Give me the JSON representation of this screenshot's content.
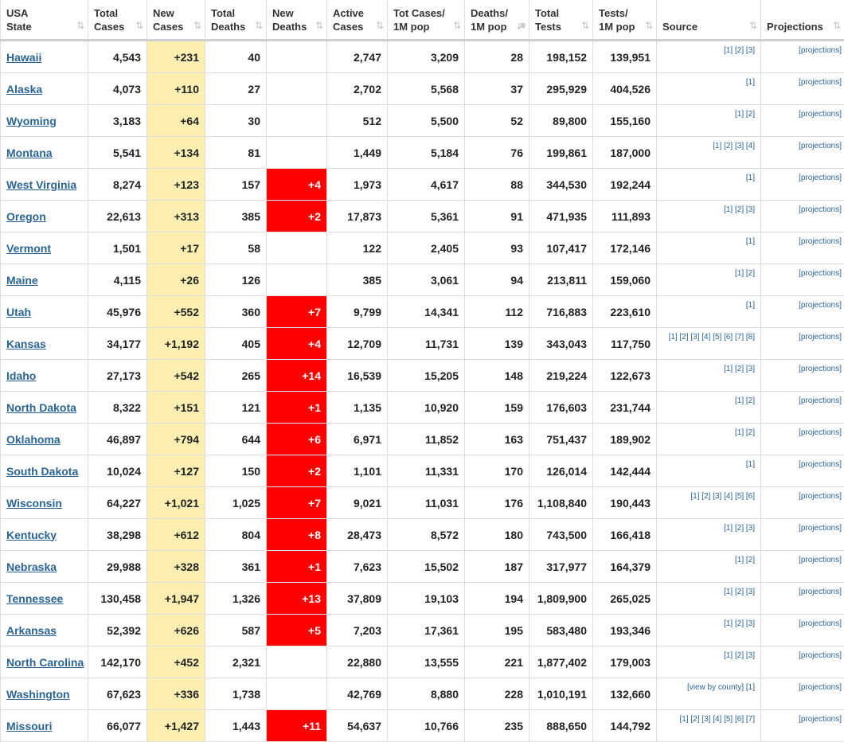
{
  "headers": [
    {
      "l1": "USA",
      "l2": "State",
      "sort": "⇅"
    },
    {
      "l1": "Total",
      "l2": "Cases",
      "sort": "⇅"
    },
    {
      "l1": "New",
      "l2": "Cases",
      "sort": "⇅"
    },
    {
      "l1": "Total",
      "l2": "Deaths",
      "sort": "⇅"
    },
    {
      "l1": "New",
      "l2": "Deaths",
      "sort": "⇅"
    },
    {
      "l1": "Active",
      "l2": "Cases",
      "sort": "⇅"
    },
    {
      "l1": "Tot Cases/",
      "l2": "1M pop",
      "sort": "⇅"
    },
    {
      "l1": "Deaths/",
      "l2": "1M pop",
      "sort": "↓≡"
    },
    {
      "l1": "Total",
      "l2": "Tests",
      "sort": "⇅"
    },
    {
      "l1": "Tests/",
      "l2": "1M pop",
      "sort": "⇅"
    },
    {
      "l1": "",
      "l2": "Source",
      "sort": "⇅"
    },
    {
      "l1": "",
      "l2": "Projections",
      "sort": "⇅"
    }
  ],
  "rows": [
    {
      "state": "Hawaii",
      "total_cases": "4,543",
      "new_cases": "+231",
      "total_deaths": "40",
      "new_deaths": "",
      "active": "2,747",
      "cases_per_m": "3,209",
      "deaths_per_m": "28",
      "total_tests": "198,152",
      "tests_per_m": "139,951",
      "source": "[1] [2] [3]",
      "projections": "[projections]"
    },
    {
      "state": "Alaska",
      "total_cases": "4,073",
      "new_cases": "+110",
      "total_deaths": "27",
      "new_deaths": "",
      "active": "2,702",
      "cases_per_m": "5,568",
      "deaths_per_m": "37",
      "total_tests": "295,929",
      "tests_per_m": "404,526",
      "source": "[1]",
      "projections": "[projections]"
    },
    {
      "state": "Wyoming",
      "total_cases": "3,183",
      "new_cases": "+64",
      "total_deaths": "30",
      "new_deaths": "",
      "active": "512",
      "cases_per_m": "5,500",
      "deaths_per_m": "52",
      "total_tests": "89,800",
      "tests_per_m": "155,160",
      "source": "[1] [2]",
      "projections": "[projections]"
    },
    {
      "state": "Montana",
      "total_cases": "5,541",
      "new_cases": "+134",
      "total_deaths": "81",
      "new_deaths": "",
      "active": "1,449",
      "cases_per_m": "5,184",
      "deaths_per_m": "76",
      "total_tests": "199,861",
      "tests_per_m": "187,000",
      "source": "[1] [2] [3] [4]",
      "projections": "[projections]"
    },
    {
      "state": "West Virginia",
      "total_cases": "8,274",
      "new_cases": "+123",
      "total_deaths": "157",
      "new_deaths": "+4",
      "active": "1,973",
      "cases_per_m": "4,617",
      "deaths_per_m": "88",
      "total_tests": "344,530",
      "tests_per_m": "192,244",
      "source": "[1]",
      "projections": "[projections]"
    },
    {
      "state": "Oregon",
      "total_cases": "22,613",
      "new_cases": "+313",
      "total_deaths": "385",
      "new_deaths": "+2",
      "active": "17,873",
      "cases_per_m": "5,361",
      "deaths_per_m": "91",
      "total_tests": "471,935",
      "tests_per_m": "111,893",
      "source": "[1] [2] [3]",
      "projections": "[projections]"
    },
    {
      "state": "Vermont",
      "total_cases": "1,501",
      "new_cases": "+17",
      "total_deaths": "58",
      "new_deaths": "",
      "active": "122",
      "cases_per_m": "2,405",
      "deaths_per_m": "93",
      "total_tests": "107,417",
      "tests_per_m": "172,146",
      "source": "[1]",
      "projections": "[projections]"
    },
    {
      "state": "Maine",
      "total_cases": "4,115",
      "new_cases": "+26",
      "total_deaths": "126",
      "new_deaths": "",
      "active": "385",
      "cases_per_m": "3,061",
      "deaths_per_m": "94",
      "total_tests": "213,811",
      "tests_per_m": "159,060",
      "source": "[1] [2]",
      "projections": "[projections]"
    },
    {
      "state": "Utah",
      "total_cases": "45,976",
      "new_cases": "+552",
      "total_deaths": "360",
      "new_deaths": "+7",
      "active": "9,799",
      "cases_per_m": "14,341",
      "deaths_per_m": "112",
      "total_tests": "716,883",
      "tests_per_m": "223,610",
      "source": "[1]",
      "projections": "[projections]"
    },
    {
      "state": "Kansas",
      "total_cases": "34,177",
      "new_cases": "+1,192",
      "total_deaths": "405",
      "new_deaths": "+4",
      "active": "12,709",
      "cases_per_m": "11,731",
      "deaths_per_m": "139",
      "total_tests": "343,043",
      "tests_per_m": "117,750",
      "source": "[1] [2] [3] [4] [5] [6] [7] [8]",
      "projections": "[projections]"
    },
    {
      "state": "Idaho",
      "total_cases": "27,173",
      "new_cases": "+542",
      "total_deaths": "265",
      "new_deaths": "+14",
      "active": "16,539",
      "cases_per_m": "15,205",
      "deaths_per_m": "148",
      "total_tests": "219,224",
      "tests_per_m": "122,673",
      "source": "[1] [2] [3]",
      "projections": "[projections]"
    },
    {
      "state": "North Dakota",
      "total_cases": "8,322",
      "new_cases": "+151",
      "total_deaths": "121",
      "new_deaths": "+1",
      "active": "1,135",
      "cases_per_m": "10,920",
      "deaths_per_m": "159",
      "total_tests": "176,603",
      "tests_per_m": "231,744",
      "source": "[1] [2]",
      "projections": "[projections]"
    },
    {
      "state": "Oklahoma",
      "total_cases": "46,897",
      "new_cases": "+794",
      "total_deaths": "644",
      "new_deaths": "+6",
      "active": "6,971",
      "cases_per_m": "11,852",
      "deaths_per_m": "163",
      "total_tests": "751,437",
      "tests_per_m": "189,902",
      "source": "[1] [2]",
      "projections": "[projections]"
    },
    {
      "state": "South Dakota",
      "total_cases": "10,024",
      "new_cases": "+127",
      "total_deaths": "150",
      "new_deaths": "+2",
      "active": "1,101",
      "cases_per_m": "11,331",
      "deaths_per_m": "170",
      "total_tests": "126,014",
      "tests_per_m": "142,444",
      "source": "[1]",
      "projections": "[projections]"
    },
    {
      "state": "Wisconsin",
      "total_cases": "64,227",
      "new_cases": "+1,021",
      "total_deaths": "1,025",
      "new_deaths": "+7",
      "active": "9,021",
      "cases_per_m": "11,031",
      "deaths_per_m": "176",
      "total_tests": "1,108,840",
      "tests_per_m": "190,443",
      "source": "[1] [2] [3] [4] [5] [6]",
      "projections": "[projections]"
    },
    {
      "state": "Kentucky",
      "total_cases": "38,298",
      "new_cases": "+612",
      "total_deaths": "804",
      "new_deaths": "+8",
      "active": "28,473",
      "cases_per_m": "8,572",
      "deaths_per_m": "180",
      "total_tests": "743,500",
      "tests_per_m": "166,418",
      "source": "[1] [2] [3]",
      "projections": "[projections]"
    },
    {
      "state": "Nebraska",
      "total_cases": "29,988",
      "new_cases": "+328",
      "total_deaths": "361",
      "new_deaths": "+1",
      "active": "7,623",
      "cases_per_m": "15,502",
      "deaths_per_m": "187",
      "total_tests": "317,977",
      "tests_per_m": "164,379",
      "source": "[1] [2]",
      "projections": "[projections]"
    },
    {
      "state": "Tennessee",
      "total_cases": "130,458",
      "new_cases": "+1,947",
      "total_deaths": "1,326",
      "new_deaths": "+13",
      "active": "37,809",
      "cases_per_m": "19,103",
      "deaths_per_m": "194",
      "total_tests": "1,809,900",
      "tests_per_m": "265,025",
      "source": "[1] [2] [3]",
      "projections": "[projections]"
    },
    {
      "state": "Arkansas",
      "total_cases": "52,392",
      "new_cases": "+626",
      "total_deaths": "587",
      "new_deaths": "+5",
      "active": "7,203",
      "cases_per_m": "17,361",
      "deaths_per_m": "195",
      "total_tests": "583,480",
      "tests_per_m": "193,346",
      "source": "[1] [2] [3]",
      "projections": "[projections]"
    },
    {
      "state": "North Carolina",
      "total_cases": "142,170",
      "new_cases": "+452",
      "total_deaths": "2,321",
      "new_deaths": "",
      "active": "22,880",
      "cases_per_m": "13,555",
      "deaths_per_m": "221",
      "total_tests": "1,877,402",
      "tests_per_m": "179,003",
      "source": "[1] [2] [3]",
      "projections": "[projections]"
    },
    {
      "state": "Washington",
      "total_cases": "67,623",
      "new_cases": "+336",
      "total_deaths": "1,738",
      "new_deaths": "",
      "active": "42,769",
      "cases_per_m": "8,880",
      "deaths_per_m": "228",
      "total_tests": "1,010,191",
      "tests_per_m": "132,660",
      "source": "[view by county] [1]",
      "projections": "[projections]"
    },
    {
      "state": "Missouri",
      "total_cases": "66,077",
      "new_cases": "+1,427",
      "total_deaths": "1,443",
      "new_deaths": "+11",
      "active": "54,637",
      "cases_per_m": "10,766",
      "deaths_per_m": "235",
      "total_tests": "888,650",
      "tests_per_m": "144,792",
      "source": "[1] [2] [3] [4] [5] [6] [7]",
      "projections": "[projections]"
    }
  ],
  "colors": {
    "new_cases_bg": "#fdefb2",
    "new_deaths_bg": "#ff0000",
    "link": "#2a6496",
    "border": "#dedede"
  }
}
